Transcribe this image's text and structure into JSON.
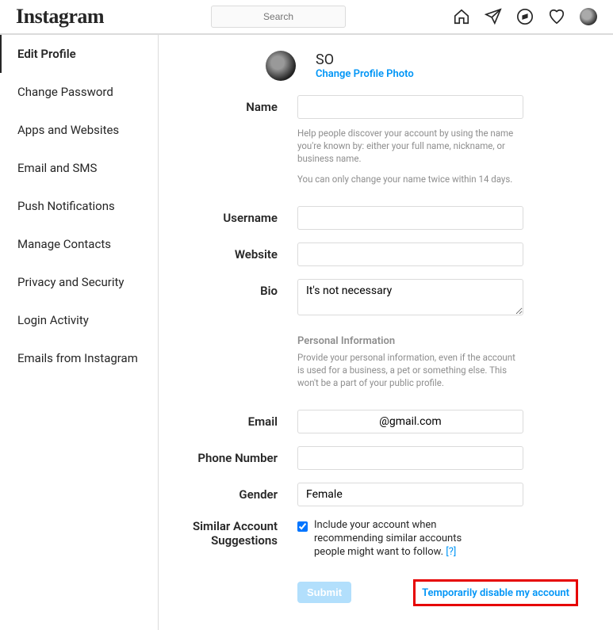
{
  "header": {
    "logo": "Instagram",
    "search_placeholder": "Search"
  },
  "sidebar": {
    "items": [
      {
        "label": "Edit Profile",
        "active": true
      },
      {
        "label": "Change Password",
        "active": false
      },
      {
        "label": "Apps and Websites",
        "active": false
      },
      {
        "label": "Email and SMS",
        "active": false
      },
      {
        "label": "Push Notifications",
        "active": false
      },
      {
        "label": "Manage Contacts",
        "active": false
      },
      {
        "label": "Privacy and Security",
        "active": false
      },
      {
        "label": "Login Activity",
        "active": false
      },
      {
        "label": "Emails from Instagram",
        "active": false
      }
    ]
  },
  "profile": {
    "username": "SO",
    "change_photo": "Change Profile Photo"
  },
  "form": {
    "name_label": "Name",
    "name_value": "",
    "name_help1": "Help people discover your account by using the name you're known by: either your full name, nickname, or business name.",
    "name_help2": "You can only change your name twice within 14 days.",
    "username_label": "Username",
    "username_value": "",
    "website_label": "Website",
    "website_value": "",
    "bio_label": "Bio",
    "bio_value": "It's not necessary",
    "personal_info_title": "Personal Information",
    "personal_info_help": "Provide your personal information, even if the account is used for a business, a pet or something else. This won't be a part of your public profile.",
    "email_label": "Email",
    "email_value": "@gmail.com",
    "phone_label": "Phone Number",
    "phone_value": "",
    "gender_label": "Gender",
    "gender_value": "Female",
    "similar_label": "Similar Account Suggestions",
    "similar_checkbox_label": "Include your account when recommending similar accounts people might want to follow.",
    "similar_qmark": "[?]",
    "submit_label": "Submit",
    "disable_link": "Temporarily disable my account"
  }
}
